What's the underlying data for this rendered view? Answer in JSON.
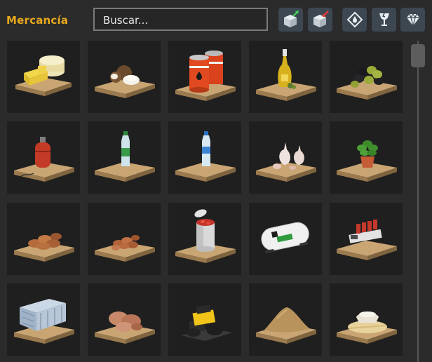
{
  "header": {
    "title": "Mercancía",
    "search_placeholder": "Buscar..."
  },
  "toolbar": [
    {
      "name": "import-cargo-button",
      "icon": "box-arrow-in-icon"
    },
    {
      "name": "export-cargo-button",
      "icon": "box-arrow-out-icon"
    },
    {
      "name": "fuel-filter-button",
      "icon": "fuel-drop-icon"
    },
    {
      "name": "fragile-filter-button",
      "icon": "glass-icon"
    },
    {
      "name": "valuable-filter-button",
      "icon": "diamond-icon"
    }
  ],
  "cargo_items": [
    {
      "name": "cargo-tile-cheese",
      "icon": "cheese-pallet-icon"
    },
    {
      "name": "cargo-tile-coconuts",
      "icon": "coconut-pallet-icon"
    },
    {
      "name": "cargo-tile-oil-barrels",
      "icon": "oil-barrels-pallet-icon"
    },
    {
      "name": "cargo-tile-olive-oil",
      "icon": "olive-oil-bottle-pallet-icon"
    },
    {
      "name": "cargo-tile-olives",
      "icon": "olives-pallet-icon"
    },
    {
      "name": "cargo-tile-gas-cylinder",
      "icon": "gas-cylinder-pallet-icon"
    },
    {
      "name": "cargo-tile-water-bottle-green",
      "icon": "water-bottle-pallet-icon"
    },
    {
      "name": "cargo-tile-water-bottle-blue",
      "icon": "water-bottle-pallet-icon"
    },
    {
      "name": "cargo-tile-garlic",
      "icon": "garlic-pallet-icon"
    },
    {
      "name": "cargo-tile-basil-plant",
      "icon": "potted-plant-pallet-icon"
    },
    {
      "name": "cargo-tile-almonds",
      "icon": "almonds-pallet-icon"
    },
    {
      "name": "cargo-tile-nuts",
      "icon": "nuts-pallet-icon"
    },
    {
      "name": "cargo-tile-canned-food",
      "icon": "canned-tomatoes-pallet-icon"
    },
    {
      "name": "cargo-tile-tank",
      "icon": "tank-cargo-icon"
    },
    {
      "name": "cargo-tile-machinery",
      "icon": "machinery-pallet-icon"
    },
    {
      "name": "cargo-tile-metal-bars",
      "icon": "metal-bars-pallet-icon"
    },
    {
      "name": "cargo-tile-meat",
      "icon": "meat-pallet-icon"
    },
    {
      "name": "cargo-tile-road-roller",
      "icon": "road-roller-pallet-icon"
    },
    {
      "name": "cargo-tile-sand",
      "icon": "sand-pile-pallet-icon"
    },
    {
      "name": "cargo-tile-flour",
      "icon": "flour-pallet-icon"
    }
  ],
  "colors": {
    "accent": "#e8a91d",
    "tile_bg": "#1f1f1f",
    "panel_bg": "#2b2b2b",
    "button_bg": "#3c4752"
  }
}
